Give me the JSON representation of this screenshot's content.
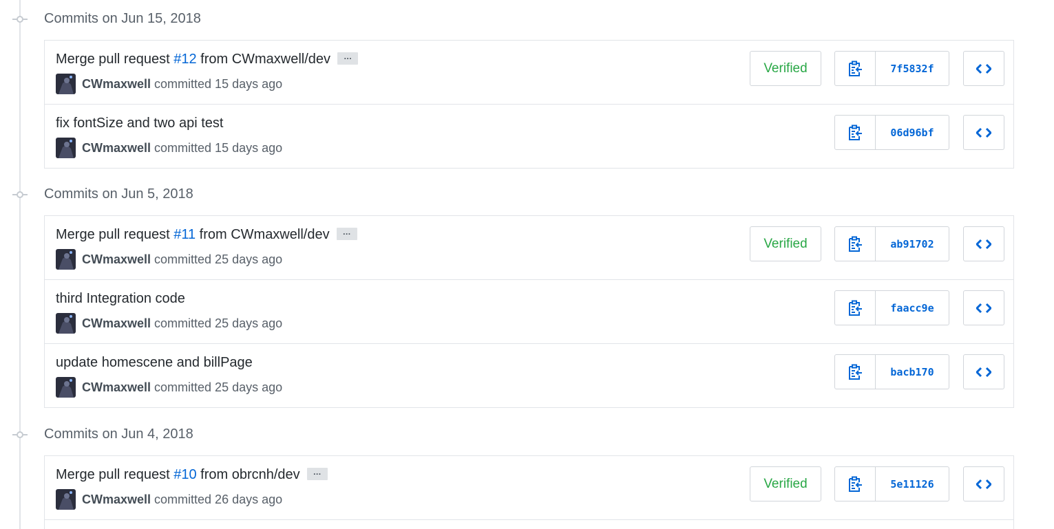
{
  "groups": [
    {
      "title": "Commits on Jun 15, 2018",
      "commits": [
        {
          "title_before": "Merge pull request ",
          "pr": "#12",
          "title_after": " from CWmaxwell/dev",
          "ellipsis": "…",
          "author": "CWmaxwell",
          "committed": " committed 15 days ago",
          "verified": "Verified",
          "sha": "7f5832f"
        },
        {
          "title_before": "fix fontSize and two api test",
          "pr": "",
          "title_after": "",
          "ellipsis": "",
          "author": "CWmaxwell",
          "committed": " committed 15 days ago",
          "verified": "",
          "sha": "06d96bf"
        }
      ]
    },
    {
      "title": "Commits on Jun 5, 2018",
      "commits": [
        {
          "title_before": "Merge pull request ",
          "pr": "#11",
          "title_after": " from CWmaxwell/dev",
          "ellipsis": "…",
          "author": "CWmaxwell",
          "committed": " committed 25 days ago",
          "verified": "Verified",
          "sha": "ab91702"
        },
        {
          "title_before": "third Integration code",
          "pr": "",
          "title_after": "",
          "ellipsis": "",
          "author": "CWmaxwell",
          "committed": " committed 25 days ago",
          "verified": "",
          "sha": "faacc9e"
        },
        {
          "title_before": "update homescene and billPage",
          "pr": "",
          "title_after": "",
          "ellipsis": "",
          "author": "CWmaxwell",
          "committed": " committed 25 days ago",
          "verified": "",
          "sha": "bacb170"
        }
      ]
    },
    {
      "title": "Commits on Jun 4, 2018",
      "commits": [
        {
          "title_before": "Merge pull request ",
          "pr": "#10",
          "title_after": " from obrcnh/dev",
          "ellipsis": "…",
          "author": "CWmaxwell",
          "committed": " committed 26 days ago",
          "verified": "Verified",
          "sha": "5e11126"
        }
      ]
    }
  ],
  "icons": {
    "group": "git-commit-icon",
    "copy": "clippy-icon",
    "browse": "code-icon",
    "avatar": "user-avatar"
  },
  "colors": {
    "link": "#0366d6",
    "verified": "#28a745",
    "border": "#e1e4e8",
    "muted": "#586069"
  }
}
